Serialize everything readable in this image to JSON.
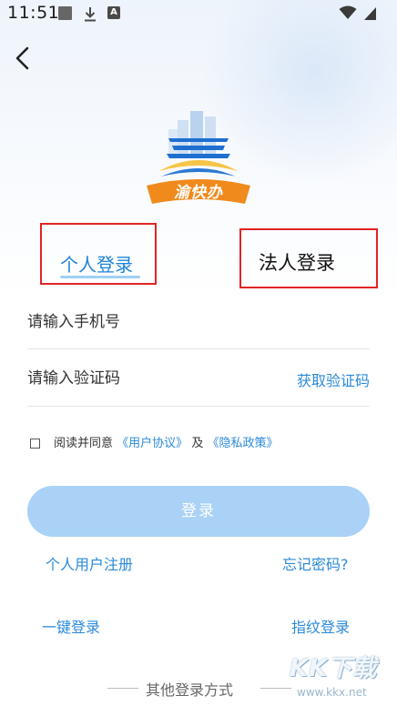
{
  "status_bar": {
    "time": "11:51",
    "icons": [
      "gallery-icon",
      "download-icon",
      "a-icon",
      "wifi-icon",
      "battery-icon"
    ],
    "a_glyph": "A"
  },
  "nav": {
    "back_icon": "chevron-left-icon"
  },
  "logo": {
    "text": "渝快办",
    "colors": {
      "blue": "#1e6fd0",
      "orange": "#f08a1c",
      "gold": "#f6c447"
    }
  },
  "tabs": {
    "personal": {
      "label": "个人登录",
      "active": true
    },
    "legal": {
      "label": "法人登录",
      "active": false
    },
    "highlight_color": "#e02424"
  },
  "form": {
    "phone_placeholder": "请输入手机号",
    "code_placeholder": "请输入验证码",
    "get_code_label": "获取验证码"
  },
  "agreement": {
    "checked": false,
    "prefix": "阅读并同意",
    "user_agreement": "《用户协议》",
    "and": "及",
    "privacy_policy": "《隐私政策》"
  },
  "login_button": {
    "label": "登录",
    "color": "#a9d2f6"
  },
  "links": {
    "register": "个人用户注册",
    "forgot_password": "忘记密码?",
    "one_key_login": "一键登录",
    "fingerprint_login": "指纹登录"
  },
  "other_login": {
    "label": "其他登录方式"
  },
  "watermark": {
    "text": "KK下载",
    "url": "www.kkx.net"
  },
  "accent_color": "#2b8ad9"
}
